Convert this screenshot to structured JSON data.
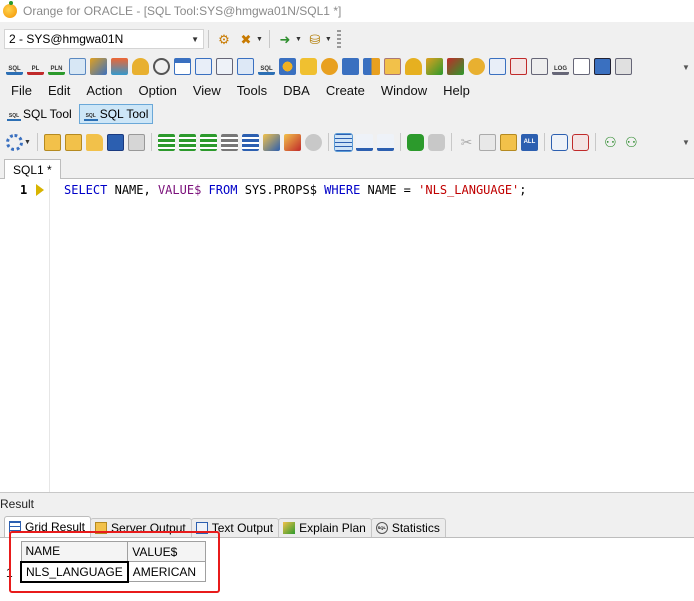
{
  "window": {
    "title": "Orange for ORACLE - [SQL Tool:SYS@hmgwa01N/SQL1 *]"
  },
  "connection": {
    "selected": "2 - SYS@hmgwa01N"
  },
  "menu": {
    "items": [
      "File",
      "Edit",
      "Action",
      "Option",
      "View",
      "Tools",
      "DBA",
      "Create",
      "Window",
      "Help"
    ]
  },
  "doc_tabs": [
    {
      "label": "SQL Tool"
    },
    {
      "label": "SQL Tool"
    }
  ],
  "editor": {
    "tab_label": "SQL1 *",
    "line_number": "1",
    "tokens": {
      "select": "SELECT",
      "name": "NAME,",
      "value": "VALUE$",
      "from": "FROM",
      "table": "SYS.PROPS$",
      "where": "WHERE",
      "name2": "NAME",
      "eq": "=",
      "literal": "'NLS_LANGUAGE'",
      "semi": ";"
    }
  },
  "results": {
    "label": "Result",
    "tabs": [
      "Grid Result",
      "Server Output",
      "Text Output",
      "Explain Plan",
      "Statistics"
    ],
    "columns": [
      "NAME",
      "VALUE$"
    ],
    "rows": [
      {
        "num": "1",
        "cells": [
          "NLS_LANGUAGE",
          "AMERICAN"
        ]
      }
    ]
  },
  "colors": {
    "keyword": "#0000c8",
    "string": "#c00000",
    "highlight": "#e81b1b"
  }
}
